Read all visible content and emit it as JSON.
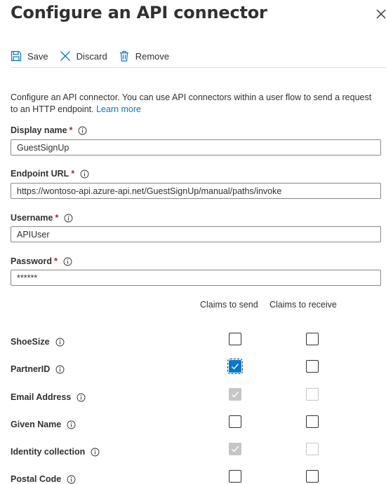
{
  "panel": {
    "title": "Configure an API connector"
  },
  "toolbar": {
    "save_label": "Save",
    "discard_label": "Discard",
    "remove_label": "Remove"
  },
  "description": {
    "text": "Configure an API connector. You can use API connectors within a user flow to send a request to an HTTP endpoint.",
    "link_label": "Learn more"
  },
  "form": {
    "display_name": {
      "label": "Display name",
      "required": "*",
      "value": "GuestSignUp"
    },
    "endpoint_url": {
      "label": "Endpoint URL",
      "required": "*",
      "value": "https://wontoso-api.azure-api.net/GuestSignUp/manual/paths/invoke"
    },
    "username": {
      "label": "Username",
      "required": "*",
      "value": "APIUser"
    },
    "password": {
      "label": "Password",
      "required": "*",
      "value": "******"
    }
  },
  "claims": {
    "col_send": "Claims to send",
    "col_receive": "Claims to receive",
    "rows": [
      {
        "label": "ShoeSize",
        "send": "unchecked",
        "receive": "unchecked"
      },
      {
        "label": "PartnerID",
        "send": "checked",
        "receive": "unchecked"
      },
      {
        "label": "Email Address",
        "send": "disabled-checked",
        "receive": "disabled"
      },
      {
        "label": "Given Name",
        "send": "unchecked",
        "receive": "unchecked"
      },
      {
        "label": "Identity collection",
        "send": "disabled-checked",
        "receive": "disabled"
      },
      {
        "label": "Postal Code",
        "send": "unchecked",
        "receive": "unchecked"
      }
    ]
  },
  "colors": {
    "accent": "#0078d4",
    "required": "#a4262c",
    "disabled": "#c8c6c4"
  }
}
